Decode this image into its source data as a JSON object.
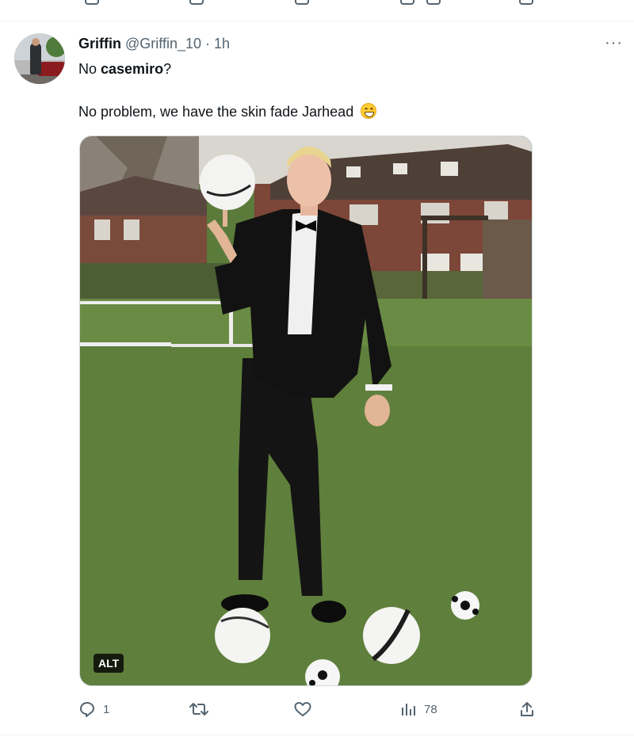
{
  "tweet": {
    "author_name": "Griffin",
    "author_handle": "@Griffin_10",
    "separator": "·",
    "time": "1h",
    "line1_prefix": "No ",
    "line1_bold": "casemiro",
    "line1_suffix": "?",
    "line2": "No problem, we have the skin fade Jarhead",
    "emoji": "grinning-face-with-smiling-eyes",
    "media_alt_badge": "ALT",
    "more_label": "···"
  },
  "actions": {
    "reply_count": "1",
    "retweet_count": "",
    "like_count": "",
    "views_count": "78"
  },
  "colors": {
    "text": "#0f1419",
    "secondary": "#536471",
    "border": "#eff3f4"
  }
}
